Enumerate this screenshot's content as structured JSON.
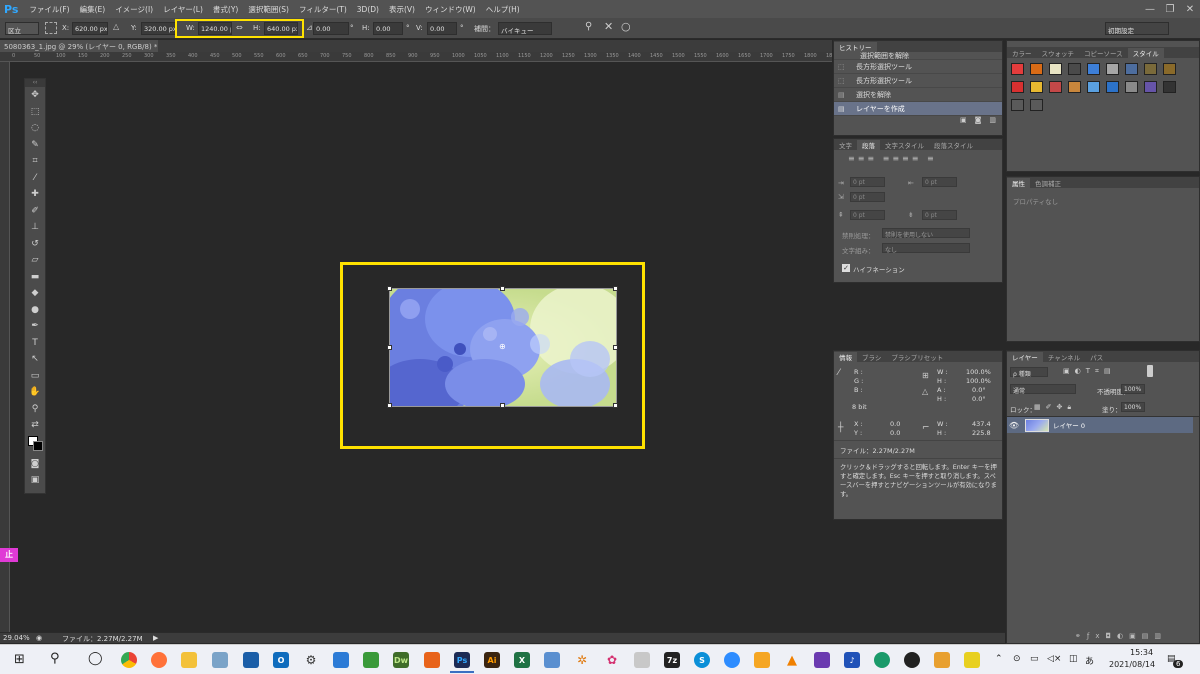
{
  "app": {
    "logo": "Ps"
  },
  "menu": [
    "ファイル(F)",
    "編集(E)",
    "イメージ(I)",
    "レイヤー(L)",
    "書式(Y)",
    "選択範囲(S)",
    "フィルター(T)",
    "3D(D)",
    "表示(V)",
    "ウィンドウ(W)",
    "ヘルプ(H)"
  ],
  "window_controls": [
    "—",
    "❐",
    "✕"
  ],
  "options": {
    "ref_point": "区立",
    "x_label": "X:",
    "x_value": "620.00 px",
    "y_label": "Y:",
    "y_value": "320.00 px",
    "w_label": "W:",
    "w_value": "1240.00 px",
    "h_label": "H:",
    "h_value": "640.00 px",
    "angle_value": "0.00",
    "angle_unit": "°",
    "hskew_label": "H:",
    "hskew_value": "0.00",
    "hskew_unit": "°",
    "vskew_label": "V:",
    "vskew_value": "0.00",
    "vskew_unit": "°",
    "interp_label": "補間：",
    "interp_value": "バイキュー",
    "workspace": "初期設定"
  },
  "document": {
    "tab_title": "5080363_1.jpg @ 29% (レイヤー 0, RGB/8) *"
  },
  "ruler_ticks": [
    "0",
    "50",
    "100",
    "150",
    "200",
    "250",
    "300",
    "350",
    "400",
    "450",
    "500",
    "550",
    "600",
    "650",
    "700",
    "750",
    "800",
    "850",
    "900",
    "950",
    "1000",
    "1050",
    "1100",
    "1150",
    "1200",
    "1250",
    "1300",
    "1350",
    "1400",
    "1450",
    "1500",
    "1550",
    "1600",
    "1650",
    "1700",
    "1750",
    "1800",
    "1850"
  ],
  "status": {
    "zoom": "29.04%",
    "file_info": "ファイル：2.27M/2.27M",
    "arrow": "▶"
  },
  "history": {
    "tab": "ヒストリー",
    "items": [
      {
        "label": "選択範囲を解除",
        "active": false
      },
      {
        "label": "長方形選択ツール",
        "active": false
      },
      {
        "label": "長方形選択ツール",
        "active": false
      },
      {
        "label": "選択を解除",
        "active": false
      },
      {
        "label": "レイヤーを作成",
        "active": true
      }
    ]
  },
  "paragraph": {
    "tabs": [
      "文字",
      "段落",
      "文字スタイル",
      "段落スタイル"
    ],
    "indent_placeholder": "0 pt",
    "kinsoku_label": "禁則処理：",
    "kinsoku_value": "禁則を使用しない",
    "mojikumi_label": "文字組み：",
    "mojikumi_value": "なし",
    "hyphen_label": "ハイフネーション",
    "hyphen_check": "✓"
  },
  "styles_panel": {
    "tabs": [
      "カラー",
      "スウォッチ",
      "コピーソース",
      "スタイル"
    ]
  },
  "style_colors": [
    "#e33c3c",
    "#d96b16",
    "#e8e4c4",
    "#4a4a4a",
    "#3d7fd8",
    "#a6a6a6",
    "#4d6d9e",
    "#7a6a3a",
    "#8a6a2a",
    "#d83030",
    "#e8b830",
    "#c44848",
    "#c8863c",
    "#5aa0e0",
    "#2c72c8",
    "#8a8a8a",
    "#6654a8",
    "#333333",
    "#5a5a5a",
    "#5a5a5a"
  ],
  "properties": {
    "tabs": [
      "属性",
      "色調補正"
    ],
    "empty": "プロパティなし"
  },
  "info": {
    "tabs": [
      "情報",
      "ブラシ",
      "ブラシプリセット"
    ],
    "r": "R :",
    "g": "G :",
    "b": "B :",
    "bit": "8 bit",
    "w_pct_label": "W :",
    "w_pct": "100.0%",
    "h_pct_label": "H :",
    "h_pct": "100.0%",
    "a_label": "A :",
    "a_val": "0.0°",
    "hh_label": "H :",
    "hh_val": "0.0°",
    "x_label": "X :",
    "x_val": "0.0",
    "y_label": "Y :",
    "y_val": "0.0",
    "w2_label": "W :",
    "w2_val": "437.4",
    "h2_label": "H :",
    "h2_val": "225.8",
    "file": "ファイル：2.27M/2.27M",
    "help": "クリック＆ドラッグすると回転します。Enter キーを押すと確定します。Esc キーを押すと取り消します。スペースバーを押すとナビゲーションツールが有効になります。"
  },
  "layers": {
    "tabs": [
      "レイヤー",
      "チャンネル",
      "パス"
    ],
    "filter": "ρ 種類",
    "blend": "通常",
    "opacity_label": "不透明度：",
    "opacity": "100%",
    "lock_label": "ロック：",
    "fill_label": "塗り：",
    "fill": "100%",
    "layer_name": "レイヤー 0"
  },
  "side_badge": "止",
  "taskbar": {
    "time": "15:34",
    "date": "2021/08/14",
    "ime": "あ",
    "notif": "6",
    "apps": [
      {
        "name": "ps",
        "label": "Ps",
        "color": "#1c2b55"
      },
      {
        "name": "ai",
        "label": "Ai",
        "color": "#3a2410"
      },
      {
        "name": "dw",
        "label": "Dw",
        "color": "#3f6d2a"
      },
      {
        "name": "excel",
        "label": "X",
        "color": "#1f7244"
      },
      {
        "name": "7zip",
        "label": "7z",
        "color": "#222222"
      },
      {
        "name": "skype",
        "label": "S",
        "color": "#0a8fd8"
      }
    ]
  },
  "colors": {
    "highlight": "#ffe200",
    "active_row": "#69738a",
    "accent": "#31a8ff"
  }
}
